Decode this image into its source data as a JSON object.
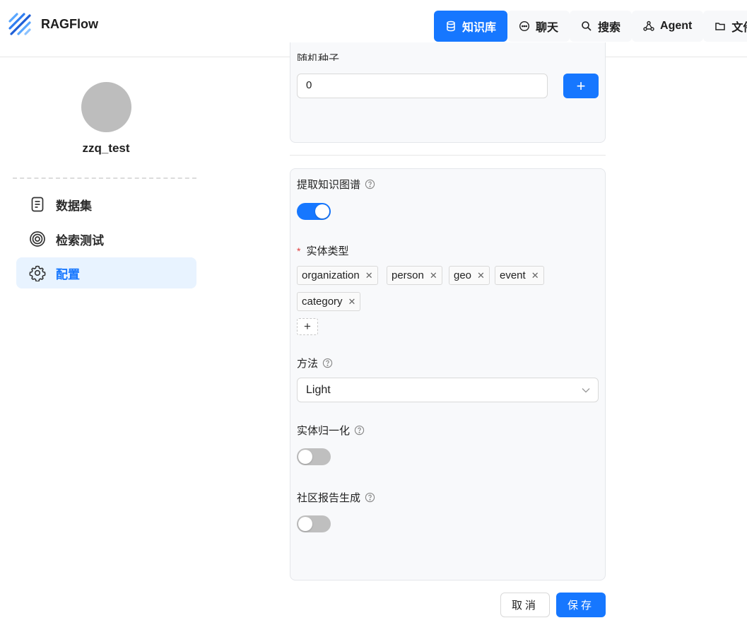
{
  "app": {
    "name": "RAGFlow"
  },
  "nav": {
    "items": [
      {
        "label": "知识库",
        "icon": "database-icon",
        "active": true
      },
      {
        "label": "聊天",
        "icon": "chat-icon",
        "active": false
      },
      {
        "label": "搜索",
        "icon": "search-icon",
        "active": false
      },
      {
        "label": "Agent",
        "icon": "agent-icon",
        "active": false
      },
      {
        "label": "文件",
        "icon": "folder-icon",
        "active": false
      }
    ]
  },
  "sidebar": {
    "username": "zzq_test",
    "items": [
      {
        "label": "数据集",
        "icon": "document-icon",
        "active": false
      },
      {
        "label": "检索测试",
        "icon": "target-icon",
        "active": false
      },
      {
        "label": "配置",
        "icon": "gear-icon",
        "active": true
      }
    ]
  },
  "form": {
    "seed_label": "随机种子",
    "seed_value": "0",
    "add_label": "+",
    "graph_label": "提取知识图谱",
    "graph_enabled": true,
    "entity_types_label": "实体类型",
    "entity_types": [
      "organization",
      "person",
      "geo",
      "event",
      "category"
    ],
    "method_label": "方法",
    "method_value": "Light",
    "entity_resolution_label": "实体归一化",
    "entity_resolution_enabled": false,
    "community_label": "社区报告生成",
    "community_enabled": false
  },
  "actions": {
    "cancel": "取消",
    "save": "保存"
  },
  "colors": {
    "accent": "#1677ff",
    "active_bg": "#e8f3ff",
    "required": "#e03e3e"
  }
}
